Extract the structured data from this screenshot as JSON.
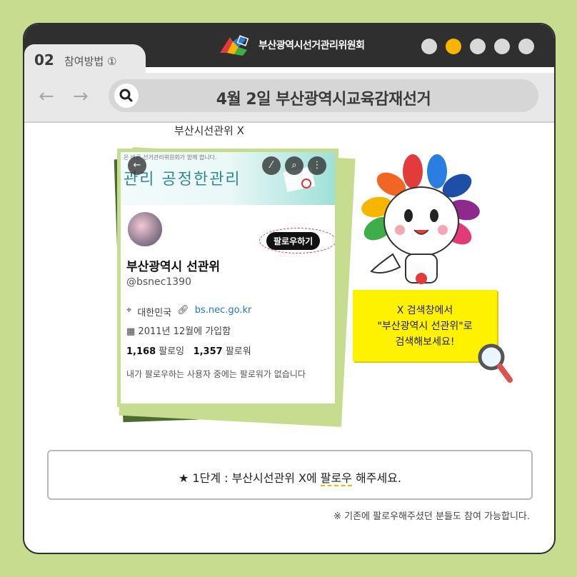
{
  "tab": {
    "number": "02",
    "label": "참여방법 ①"
  },
  "header": {
    "org_name": "부산광역시선거관리위원회"
  },
  "pager": {
    "total": 5,
    "active": 2
  },
  "search": {
    "query": "4월 2일 부산광역시교육감재선거"
  },
  "post_label": "부산시선관위 X",
  "profile": {
    "banner_small_text": "은 바른 선거관리위원회가 함께 합니다.",
    "banner_slogan": "관리 공정한관리",
    "follow_label": "팔로우하기",
    "name": "부산광역시 선관위",
    "handle": "@bsnec1390",
    "location": "대한민국",
    "website": "bs.nec.go.kr",
    "joined": "2011년 12월에 가입함",
    "following_count": "1,168",
    "following_label": "팔로잉",
    "followers_count": "1,357",
    "followers_label": "팔로워",
    "note": "내가 팔로우하는 사용자 중에는 팔로워가 없습니다"
  },
  "callout": {
    "line1": "X 검색창에서",
    "line2": "\"부산광역시 선관위\"로",
    "line3": "검색해보세요!"
  },
  "step": {
    "prefix": "★ 1단계 : 부산시선관위 X에 ",
    "highlight": "팔로우",
    "suffix": " 해주세요."
  },
  "footnote": "※ 기존에 팔로우해주셨던 분들도 참여 가능합니다.",
  "colors": {
    "background": "#c6dc8e",
    "titlebar": "#2f2f2f",
    "accent": "#f7b500",
    "callout": "#fff200",
    "follow_ring": "#e23b3b"
  }
}
